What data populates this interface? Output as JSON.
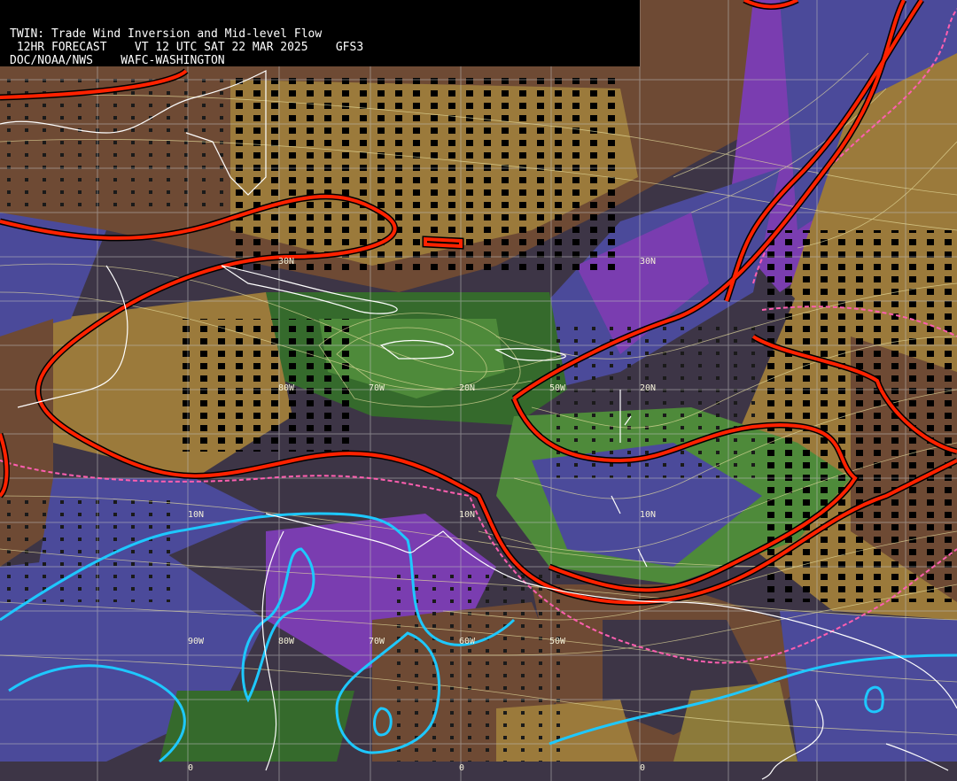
{
  "header": {
    "title": "TWIN: Trade Wind Inversion and Mid-level Flow",
    "forecast_line": " 12HR FORECAST    VT 12 UTC SAT 22 MAR 2025    GFS3",
    "agency_line": "DOC/NOAA/NWS    WAFC-WASHINGTON"
  },
  "grid_labels": [
    {
      "text": "30N",
      "lat": 30,
      "lon": -40
    },
    {
      "text": "20N",
      "lat": 20,
      "lon": -60
    },
    {
      "text": "10N",
      "lat": 10,
      "lon": -90
    },
    {
      "text": "10N",
      "lat": 10,
      "lon": -60
    },
    {
      "text": "10N",
      "lat": 10,
      "lon": -40
    },
    {
      "text": "30N",
      "lat": 30,
      "lon": -80
    },
    {
      "text": "20N",
      "lat": 20,
      "lon": -40
    },
    {
      "text": "80W",
      "lat": 20,
      "lon": -80
    },
    {
      "text": "70W",
      "lat": 20,
      "lon": -70
    },
    {
      "text": "50W",
      "lat": 20,
      "lon": -50
    },
    {
      "text": "90W",
      "lat": 0,
      "lon": -90
    },
    {
      "text": "80W",
      "lat": 0,
      "lon": -80
    },
    {
      "text": "70W",
      "lat": 0,
      "lon": -70
    },
    {
      "text": "60W",
      "lat": 0,
      "lon": -60
    },
    {
      "text": "50W",
      "lat": 0,
      "lon": -50
    },
    {
      "text": "0",
      "lat": -10,
      "lon": -90
    },
    {
      "text": "0",
      "lat": -10,
      "lon": -60
    },
    {
      "text": "0",
      "lat": -10,
      "lon": -40
    }
  ],
  "colors": {
    "background": "#3d3546",
    "brown": "#6e4a34",
    "tan": "#9b7a3b",
    "olive": "#8c7a3a",
    "green_dark": "#356a2c",
    "green_light": "#4e8a3a",
    "purple": "#7a3db0",
    "blue_purple": "#4b4a9a",
    "contour_red": "#ff2200",
    "contour_pink": "#ff5fb0",
    "contour_cyan": "#1ec8ff",
    "coastline": "#ffffff",
    "grid": "#bcbcbc",
    "streamline": "#e8e0a0"
  }
}
